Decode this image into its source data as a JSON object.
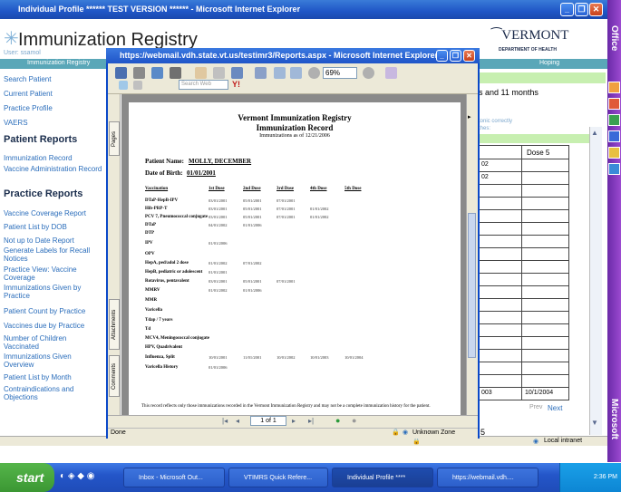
{
  "outer_window": {
    "title": "Individual Profile ****** TEST VERSION ****** - Microsoft Internet Explorer"
  },
  "header": {
    "app_title": "Immunization Registry",
    "user_label": "User: ssamol",
    "nav_left": "Immunization Registry",
    "nav_right": "Hoping",
    "vermont_logo": "VERMONT",
    "vermont_sub": "DEPARTMENT OF HEALTH"
  },
  "sidebar": {
    "items_top": [
      "Search Patient",
      "Current Patient",
      "Practice Profile",
      "VAERS"
    ],
    "patient_reports_heading": "Patient Reports",
    "patient_reports": [
      "Immunization Record",
      "Vaccine Administration Record"
    ],
    "practice_reports_heading": "Practice Reports",
    "practice_reports": [
      "Vaccine Coverage Report",
      "Patient List by DOB",
      "Not up to Date Report",
      "Generate Labels for Recall Notices",
      "Practice View: Vaccine Coverage",
      "Immunizations Given by Practice",
      "Patient Count by Practice",
      "Vaccines due by Practice",
      "Number of Children Vaccinated",
      "Immunizations Given Overview",
      "Patient List by Month",
      "Contraindications and Objections"
    ]
  },
  "right_panel": {
    "age_text": "s and 11 months",
    "notice_text": "tonic correctly",
    "notice_text2": "thes:",
    "col_header": "Dose 5",
    "rows": [
      "02",
      "02"
    ],
    "bottom_left": "003",
    "bottom_date": "10/1/2004",
    "prev": "Prev",
    "next": "Next",
    "bottom_num": "5"
  },
  "popup": {
    "title": "https://webmail.vdh.state.vt.us/testimr3/Reports.aspx - Microsoft Internet Explorer",
    "zoom": "69%",
    "search_placeholder": "Search Web",
    "tabs": [
      "Pages",
      "Attachments",
      "Comments"
    ],
    "page_indicator": "1 of 1",
    "status_left": "Done",
    "status_zone": "Unknown Zone"
  },
  "document": {
    "title1": "Vermont Immunization Registry",
    "title2": "Immunization Record",
    "as_of": "Immunizations as of 12/21/2006",
    "patient_label": "Patient Name:",
    "patient_name": "MOLLY, DECEMBER",
    "dob_label": "Date of Birth:",
    "dob": "01/01/2001",
    "columns": [
      "Vaccination",
      "1st Dose",
      "2nd Dose",
      "3rd Dose",
      "4th Dose",
      "5th Dose"
    ],
    "rows": [
      [
        "DTaP-HepB-IPV",
        "03/01/2001",
        "05/01/2001",
        "07/01/2001",
        "",
        ""
      ],
      [
        "Hib-PRP-T",
        "03/01/2001",
        "05/01/2001",
        "07/01/2001",
        "01/01/2002",
        ""
      ],
      [
        "PCV 7, Pneumococcal conjugate",
        "03/01/2001",
        "05/01/2001",
        "07/01/2001",
        "01/01/2002",
        ""
      ],
      [
        "DTaP",
        "04/01/2002",
        "01/01/2006",
        "",
        "",
        ""
      ],
      [
        "DTP",
        "",
        "",
        "",
        "",
        ""
      ],
      [
        "IPV",
        "01/01/2006",
        "",
        "",
        "",
        ""
      ],
      [
        "OPV",
        "",
        "",
        "",
        "",
        ""
      ],
      [
        "HepA, ped/adol 2 dose",
        "01/01/2002",
        "07/01/2002",
        "",
        "",
        ""
      ],
      [
        "HepB, pediatric or adolescent",
        "01/01/2001",
        "",
        "",
        "",
        ""
      ],
      [
        "Rotavirus, pentavalent",
        "03/01/2001",
        "05/01/2001",
        "07/01/2001",
        "",
        ""
      ],
      [
        "MMRV",
        "01/01/2002",
        "01/01/2006",
        "",
        "",
        ""
      ],
      [
        "MMR",
        "",
        "",
        "",
        "",
        ""
      ],
      [
        "Varicella",
        "",
        "",
        "",
        "",
        ""
      ],
      [
        "Tdap / 7 years",
        "",
        "",
        "",
        "",
        ""
      ],
      [
        "Td",
        "",
        "",
        "",
        "",
        ""
      ],
      [
        "MCV4, Meningococcal conjugate",
        "",
        "",
        "",
        "",
        ""
      ],
      [
        "HPV, Quadrivalent",
        "",
        "",
        "",
        "",
        ""
      ],
      [
        "Influenza, Split",
        "10/01/2001",
        "11/01/2001",
        "10/01/2002",
        "10/01/2003",
        "10/01/2004"
      ],
      [
        "Varicella History",
        "01/01/2006",
        "",
        "",
        "",
        ""
      ]
    ],
    "footer": "This record reflects only those immunizations recorded in the Vermont Immunization Registry and may not be a complete immunization history for the patient."
  },
  "outer_status": {
    "zone": "Local intranet"
  },
  "office_bar": {
    "top": "Office",
    "bottom": "Microsoft"
  },
  "taskbar": {
    "start": "start",
    "tasks": [
      "Inbox - Microsoft Out...",
      "VTIMRS Quick Refere...",
      "Individual Profile ****",
      "https://webmail.vdh...."
    ],
    "clock": "2:36 PM"
  }
}
